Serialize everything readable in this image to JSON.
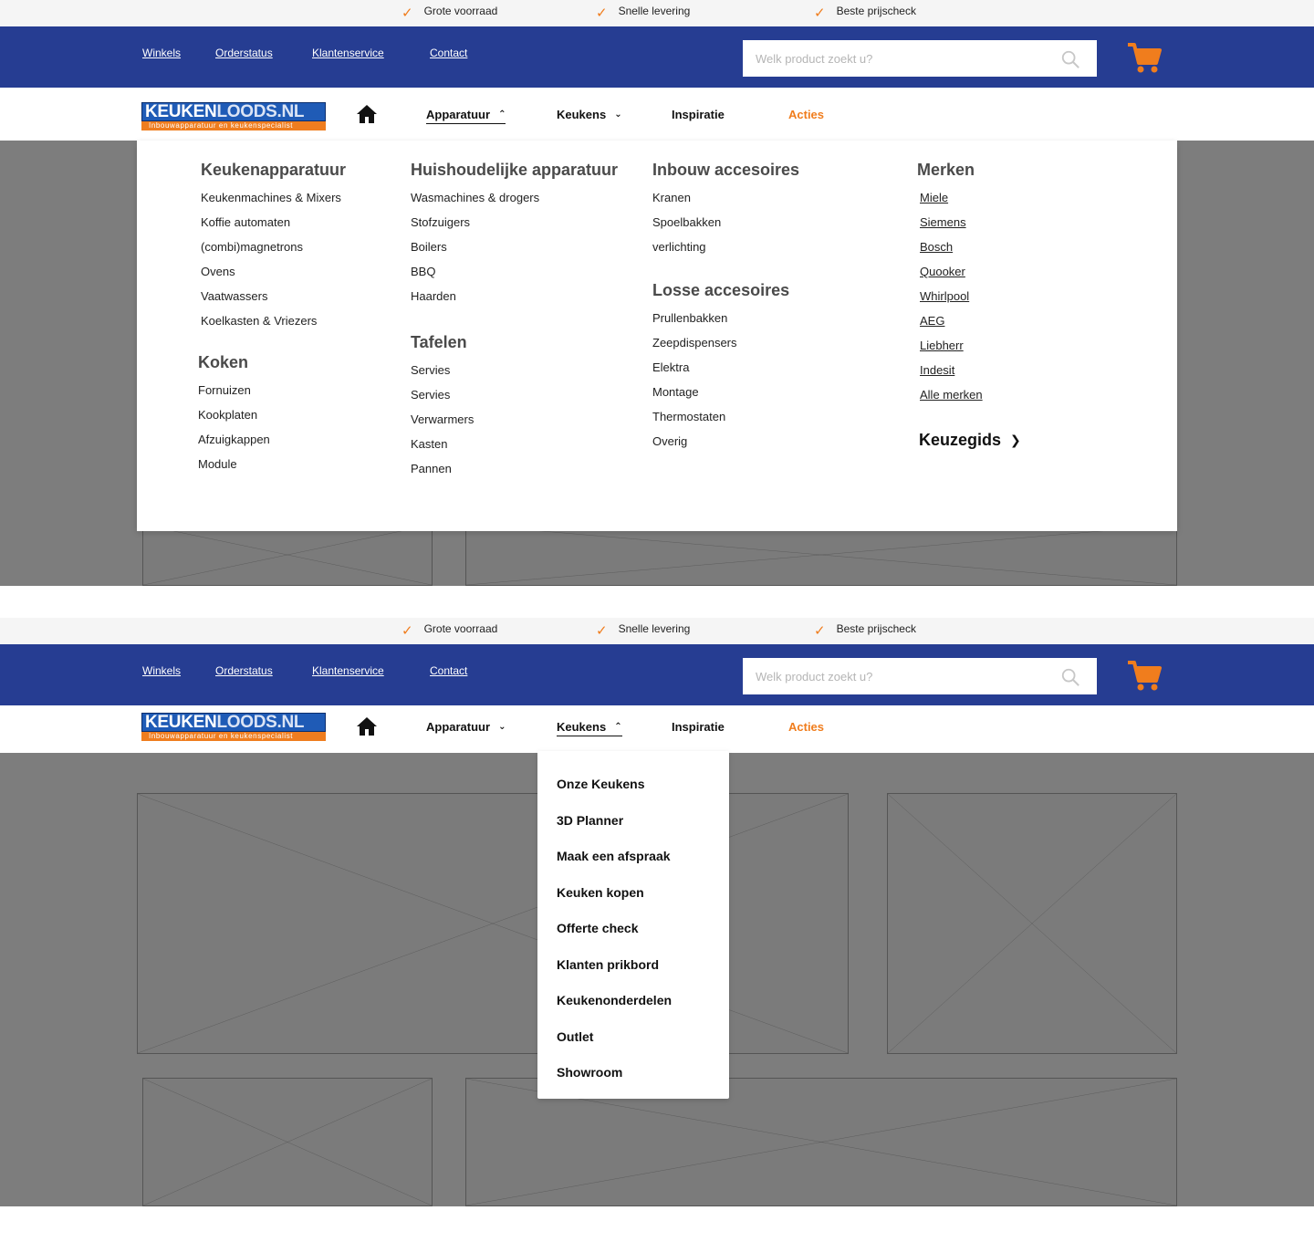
{
  "usps": [
    "Grote voorraad",
    "Snelle levering",
    "Beste prijscheck"
  ],
  "toplinks": [
    "Winkels",
    "Orderstatus",
    "Klantenservice",
    "Contact"
  ],
  "search": {
    "placeholder": "Welk product zoekt u?"
  },
  "logo": {
    "word1": "KEUKEN",
    "word2": "LOODS.NL",
    "tagline": "Inbouwapparatuur en keukenspecialist"
  },
  "nav": {
    "apparatuur": "Apparatuur",
    "keukens": "Keukens",
    "inspiratie": "Inspiratie",
    "acties": "Acties"
  },
  "colors": {
    "header_blue": "#263d92",
    "accent_orange": "#f07d1d",
    "placeholder_gray": "#7d7d7d"
  },
  "mega_menu": {
    "keukenapparatuur": {
      "title": "Keukenapparatuur",
      "items": [
        "Keukenmachines & Mixers",
        "Koffie automaten",
        "(combi)magnetrons",
        "Ovens",
        "Vaatwassers",
        "Koelkasten & Vriezers"
      ]
    },
    "koken": {
      "title": "Koken",
      "items": [
        "Fornuizen",
        "Kookplaten",
        "Afzuigkappen",
        "Module"
      ]
    },
    "huishoudelijk": {
      "title": "Huishoudelijke apparatuur",
      "items": [
        "Wasmachines & drogers",
        "Stofzuigers",
        "Boilers",
        "BBQ",
        "Haarden"
      ]
    },
    "tafelen": {
      "title": "Tafelen",
      "items": [
        "Servies",
        "Servies",
        "Verwarmers",
        "Kasten",
        "Pannen"
      ]
    },
    "inbouw": {
      "title": "Inbouw accesoires",
      "items": [
        "Kranen",
        "Spoelbakken",
        "verlichting"
      ]
    },
    "losse": {
      "title": "Losse accesoires",
      "items": [
        "Prullenbakken",
        "Zeepdispensers",
        "Elektra",
        "Montage",
        "Thermostaten",
        "Overig"
      ]
    },
    "merken": {
      "title": "Merken",
      "items": [
        "Miele",
        "Siemens",
        "Bosch",
        "Quooker",
        "Whirlpool",
        "AEG",
        "Liebherr",
        "Indesit",
        "Alle merken"
      ]
    },
    "keuzegids": "Keuzegids"
  },
  "keukens_menu": [
    "Onze Keukens",
    "3D Planner",
    "Maak een afspraak",
    "Keuken kopen",
    "Offerte check",
    "Klanten prikbord",
    "Keukenonderdelen",
    "Outlet",
    "Showroom"
  ]
}
